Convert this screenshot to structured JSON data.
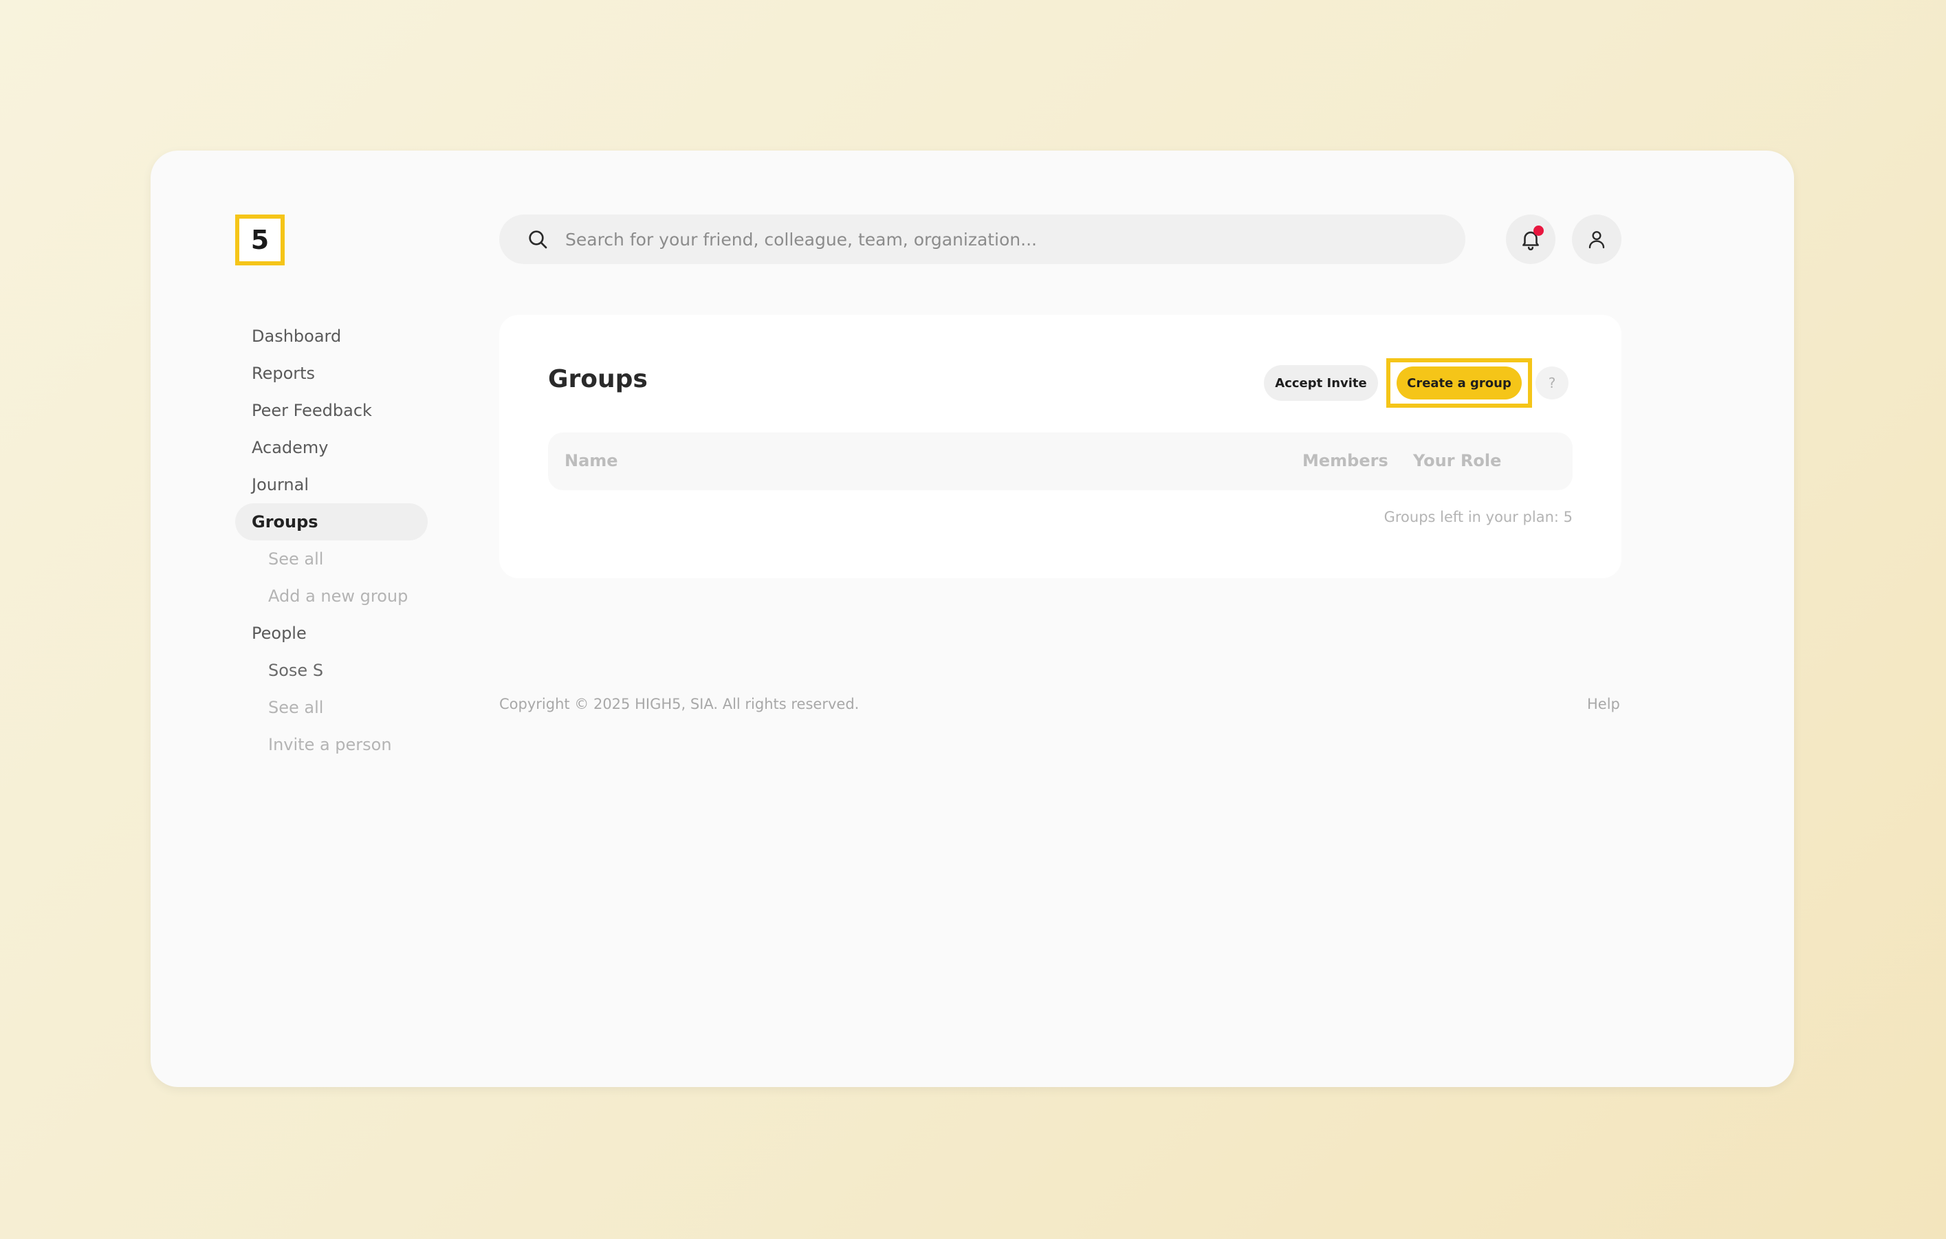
{
  "app": {
    "logo_text": "5",
    "brand_color": "#f5c518",
    "notification_dot_color": "#e8173f"
  },
  "search": {
    "placeholder": "Search for your friend, colleague, team, organization..."
  },
  "header": {
    "icons": [
      "search-icon",
      "bell-icon",
      "user-icon"
    ]
  },
  "sidebar": {
    "items": [
      {
        "label": "Dashboard"
      },
      {
        "label": "Reports"
      },
      {
        "label": "Peer Feedback"
      },
      {
        "label": "Academy"
      },
      {
        "label": "Journal"
      },
      {
        "label": "Groups",
        "active": true
      },
      {
        "label": "See all"
      },
      {
        "label": "Add a new group"
      },
      {
        "label": "People"
      },
      {
        "label": "Sose S"
      },
      {
        "label": "See all"
      },
      {
        "label": "Invite a person"
      }
    ]
  },
  "main": {
    "title": "Groups",
    "accept_invite_label": "Accept Invite",
    "create_group_label": "Create a group",
    "help_label": "?",
    "table": {
      "columns": [
        "Name",
        "Members",
        "Your Role"
      ],
      "rows": []
    },
    "plan_text": "Groups left in your plan: 5"
  },
  "footer": {
    "copyright": "Copyright © 2025 HIGH5, SIA. All rights reserved.",
    "help_label": "Help"
  }
}
